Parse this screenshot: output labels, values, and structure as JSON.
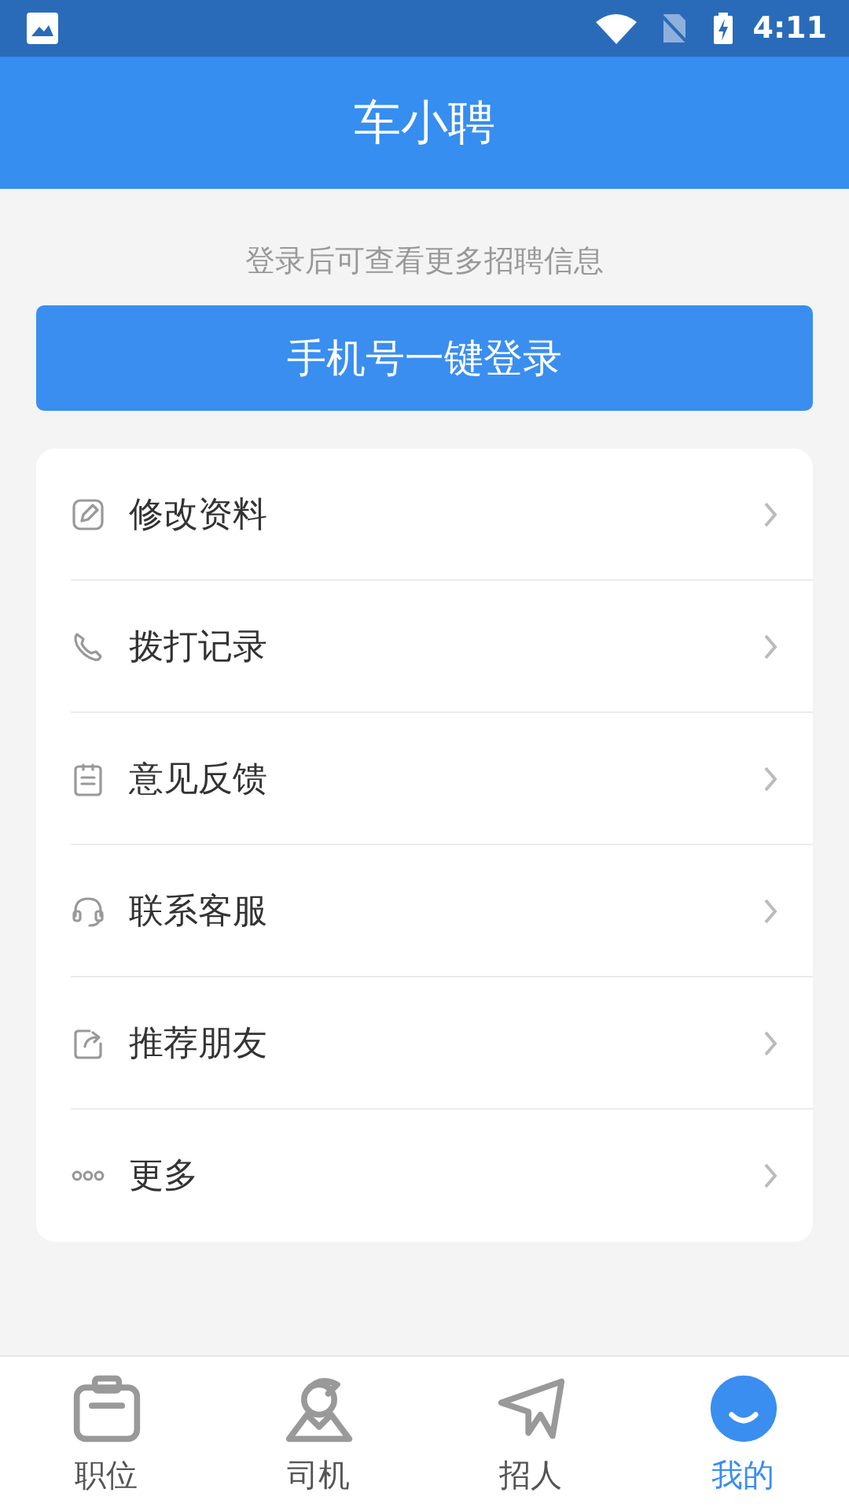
{
  "status_bar": {
    "time": "4:11"
  },
  "header": {
    "title": "车小聘"
  },
  "login_hint": "登录后可查看更多招聘信息",
  "login_button": "手机号一键登录",
  "menu": [
    {
      "kind": "edit",
      "label": "修改资料"
    },
    {
      "kind": "phone",
      "label": "拨打记录"
    },
    {
      "kind": "feedback",
      "label": "意见反馈"
    },
    {
      "kind": "service",
      "label": "联系客服"
    },
    {
      "kind": "share",
      "label": "推荐朋友"
    },
    {
      "kind": "more",
      "label": "更多"
    }
  ],
  "tabs": [
    {
      "kind": "jobs",
      "label": "职位",
      "selected": false
    },
    {
      "kind": "drivers",
      "label": "司机",
      "selected": false
    },
    {
      "kind": "hire",
      "label": "招人",
      "selected": false
    },
    {
      "kind": "mine",
      "label": "我的",
      "selected": true
    }
  ]
}
